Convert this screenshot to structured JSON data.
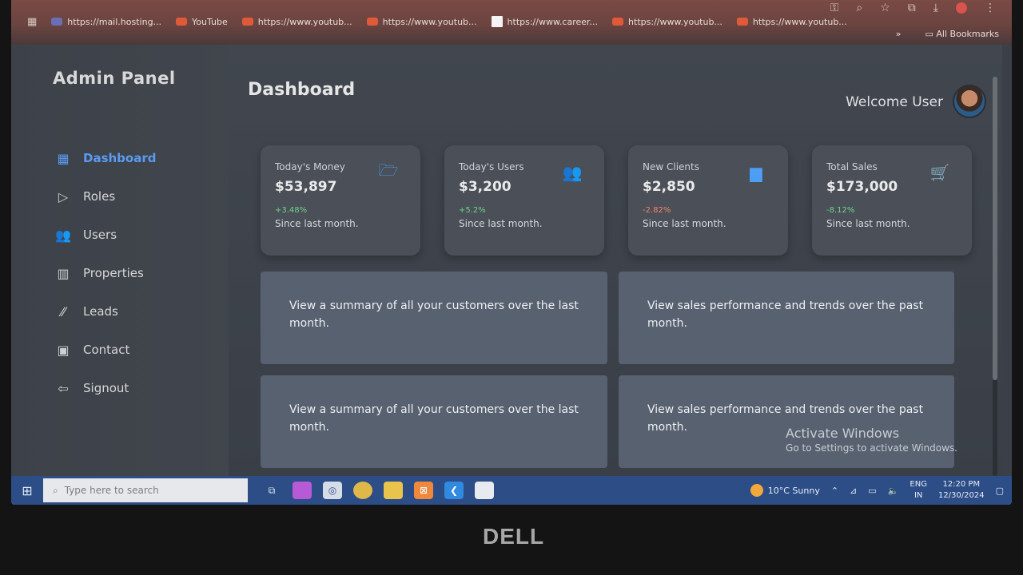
{
  "browser": {
    "bookmarks": [
      {
        "label": "https://mail.hosting...",
        "icon": "mail-favicon"
      },
      {
        "label": "YouTube",
        "icon": "youtube-favicon"
      },
      {
        "label": "https://www.youtub...",
        "icon": "youtube-favicon"
      },
      {
        "label": "https://www.youtub...",
        "icon": "youtube-favicon"
      },
      {
        "label": "https://www.career...",
        "icon": "career-favicon"
      },
      {
        "label": "https://www.youtub...",
        "icon": "youtube-favicon"
      },
      {
        "label": "https://www.youtub...",
        "icon": "youtube-favicon"
      }
    ],
    "more_label": "»",
    "all_bookmarks_label": "All Bookmarks"
  },
  "sidebar": {
    "brand": "Admin Panel",
    "items": [
      {
        "label": "Dashboard",
        "icon": "grid-icon",
        "active": true
      },
      {
        "label": "Roles",
        "icon": "play-outline-icon",
        "active": false
      },
      {
        "label": "Users",
        "icon": "users-icon",
        "active": false
      },
      {
        "label": "Properties",
        "icon": "building-icon",
        "active": false
      },
      {
        "label": "Leads",
        "icon": "leads-icon",
        "active": false
      },
      {
        "label": "Contact",
        "icon": "contact-card-icon",
        "active": false
      },
      {
        "label": "Signout",
        "icon": "signout-icon",
        "active": false
      }
    ]
  },
  "header": {
    "title": "Dashboard",
    "welcome": "Welcome User"
  },
  "stats": [
    {
      "label": "Today's Money",
      "value": "$53,897",
      "change": "+3.48%",
      "direction": "up",
      "sub": "Since last month.",
      "icon": "folder-icon"
    },
    {
      "label": "Today's Users",
      "value": "$3,200",
      "change": "+5.2%",
      "direction": "up",
      "sub": "Since last month.",
      "icon": "users-icon"
    },
    {
      "label": "New Clients",
      "value": "$2,850",
      "change": "-2.82%",
      "direction": "down",
      "sub": "Since last month.",
      "icon": "file-icon"
    },
    {
      "label": "Total Sales",
      "value": "$173,000",
      "change": "-8.12%",
      "direction": "up",
      "sub": "Since last month.",
      "icon": "cart-icon"
    }
  ],
  "panels": [
    {
      "text": "View a summary of all your customers over the last month."
    },
    {
      "text": "View sales performance and trends over the past month."
    },
    {
      "text": "View a summary of all your customers over the last month."
    },
    {
      "text": "View sales performance and trends over the past month."
    }
  ],
  "watermark": {
    "title": "Activate Windows",
    "subtitle": "Go to Settings to activate Windows."
  },
  "taskbar": {
    "search_placeholder": "Type here to search",
    "weather": "10°C  Sunny",
    "lang_top": "ENG",
    "lang_bottom": "IN",
    "time": "12:20 PM",
    "date": "12/30/2024"
  },
  "device": {
    "brand": "DELL"
  },
  "colors": {
    "accent": "#5a9bf0",
    "positive": "#6fd28a",
    "negative": "#f2856c",
    "card": "#4a4f58",
    "panel": "#586170"
  }
}
